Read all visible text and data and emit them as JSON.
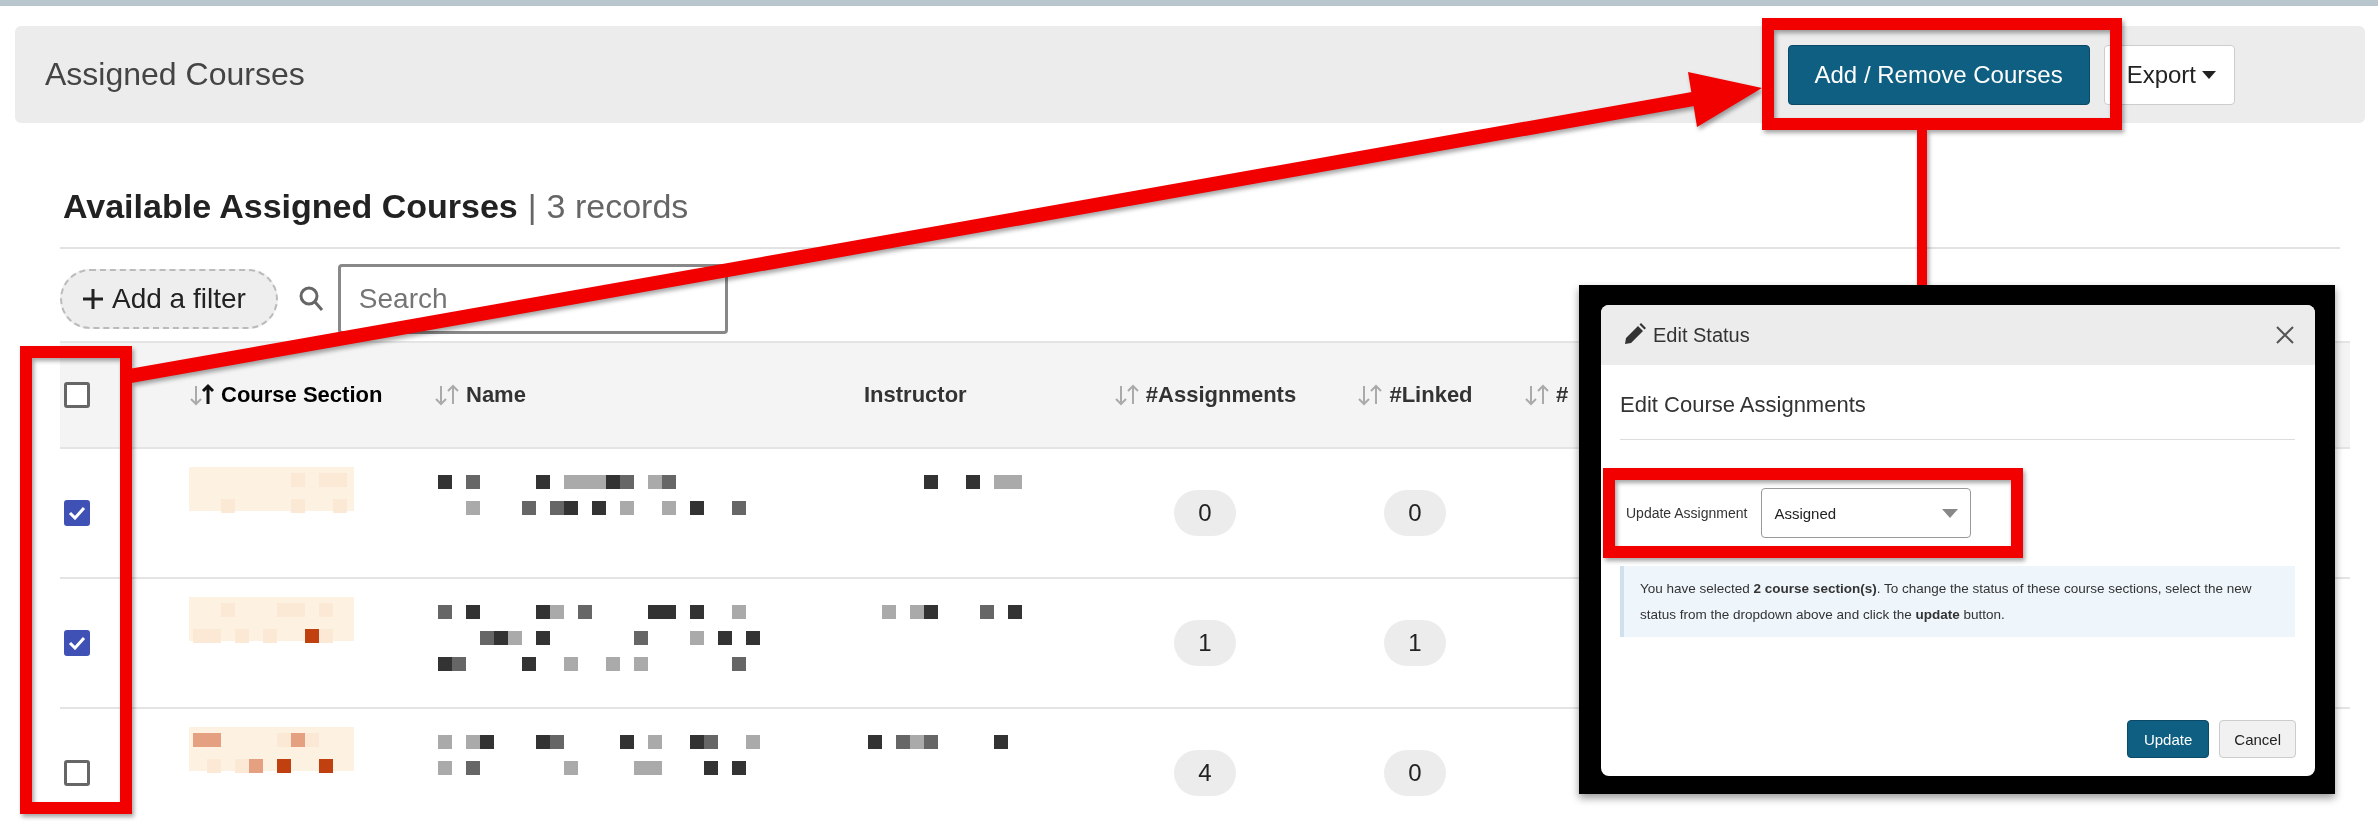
{
  "page_header": {
    "title": "Assigned Courses",
    "primary_button": "Add / Remove Courses",
    "export_button": "Export"
  },
  "section": {
    "title": "Available Assigned Courses",
    "separator": "|",
    "count": "3 records"
  },
  "toolbar": {
    "filter_button": "Add a filter",
    "search": {
      "placeholder": "Search"
    }
  },
  "table": {
    "select_all": {
      "checked": false
    },
    "columns": [
      {
        "label": "Course Section",
        "sortable": true,
        "sorted": true
      },
      {
        "label": "Name",
        "sortable": true,
        "sorted": false
      },
      {
        "label": "Instructor",
        "sortable": false,
        "sorted": false
      },
      {
        "label": "#Assignments",
        "sortable": true,
        "sorted": false
      },
      {
        "label": "#Linked",
        "sortable": true,
        "sorted": false
      },
      {
        "label": "#",
        "sortable": true,
        "sorted": false
      }
    ],
    "rows": [
      {
        "checked": true,
        "assignments": "0",
        "linked": "0"
      },
      {
        "checked": true,
        "assignments": "1",
        "linked": "1"
      },
      {
        "checked": false,
        "assignments": "4",
        "linked": "0"
      }
    ]
  },
  "modal": {
    "title": "Edit Status",
    "heading": "Edit Course Assignments",
    "field": {
      "label": "Update Assignment",
      "value": "Assigned"
    },
    "info": "You have selected **2 course section(s)**. To change the status of these course sections, select the new status from the dropdown above and click the **update** button.",
    "buttons": [
      {
        "label": "Update",
        "kind": "primary"
      },
      {
        "label": "Cancel",
        "kind": "secondary"
      }
    ]
  }
}
